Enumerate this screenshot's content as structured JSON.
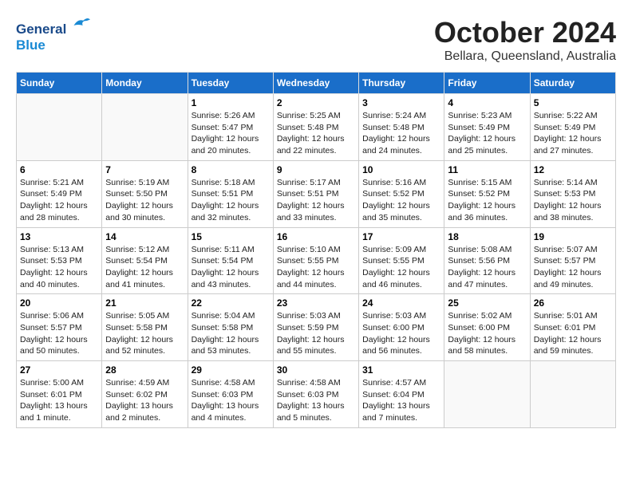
{
  "header": {
    "logo_general": "General",
    "logo_blue": "Blue",
    "month_title": "October 2024",
    "subtitle": "Bellara, Queensland, Australia"
  },
  "weekdays": [
    "Sunday",
    "Monday",
    "Tuesday",
    "Wednesday",
    "Thursday",
    "Friday",
    "Saturday"
  ],
  "weeks": [
    [
      {
        "day": "",
        "sunrise": "",
        "sunset": "",
        "daylight": ""
      },
      {
        "day": "",
        "sunrise": "",
        "sunset": "",
        "daylight": ""
      },
      {
        "day": "1",
        "sunrise": "Sunrise: 5:26 AM",
        "sunset": "Sunset: 5:47 PM",
        "daylight": "Daylight: 12 hours and 20 minutes."
      },
      {
        "day": "2",
        "sunrise": "Sunrise: 5:25 AM",
        "sunset": "Sunset: 5:48 PM",
        "daylight": "Daylight: 12 hours and 22 minutes."
      },
      {
        "day": "3",
        "sunrise": "Sunrise: 5:24 AM",
        "sunset": "Sunset: 5:48 PM",
        "daylight": "Daylight: 12 hours and 24 minutes."
      },
      {
        "day": "4",
        "sunrise": "Sunrise: 5:23 AM",
        "sunset": "Sunset: 5:49 PM",
        "daylight": "Daylight: 12 hours and 25 minutes."
      },
      {
        "day": "5",
        "sunrise": "Sunrise: 5:22 AM",
        "sunset": "Sunset: 5:49 PM",
        "daylight": "Daylight: 12 hours and 27 minutes."
      }
    ],
    [
      {
        "day": "6",
        "sunrise": "Sunrise: 5:21 AM",
        "sunset": "Sunset: 5:49 PM",
        "daylight": "Daylight: 12 hours and 28 minutes."
      },
      {
        "day": "7",
        "sunrise": "Sunrise: 5:19 AM",
        "sunset": "Sunset: 5:50 PM",
        "daylight": "Daylight: 12 hours and 30 minutes."
      },
      {
        "day": "8",
        "sunrise": "Sunrise: 5:18 AM",
        "sunset": "Sunset: 5:51 PM",
        "daylight": "Daylight: 12 hours and 32 minutes."
      },
      {
        "day": "9",
        "sunrise": "Sunrise: 5:17 AM",
        "sunset": "Sunset: 5:51 PM",
        "daylight": "Daylight: 12 hours and 33 minutes."
      },
      {
        "day": "10",
        "sunrise": "Sunrise: 5:16 AM",
        "sunset": "Sunset: 5:52 PM",
        "daylight": "Daylight: 12 hours and 35 minutes."
      },
      {
        "day": "11",
        "sunrise": "Sunrise: 5:15 AM",
        "sunset": "Sunset: 5:52 PM",
        "daylight": "Daylight: 12 hours and 36 minutes."
      },
      {
        "day": "12",
        "sunrise": "Sunrise: 5:14 AM",
        "sunset": "Sunset: 5:53 PM",
        "daylight": "Daylight: 12 hours and 38 minutes."
      }
    ],
    [
      {
        "day": "13",
        "sunrise": "Sunrise: 5:13 AM",
        "sunset": "Sunset: 5:53 PM",
        "daylight": "Daylight: 12 hours and 40 minutes."
      },
      {
        "day": "14",
        "sunrise": "Sunrise: 5:12 AM",
        "sunset": "Sunset: 5:54 PM",
        "daylight": "Daylight: 12 hours and 41 minutes."
      },
      {
        "day": "15",
        "sunrise": "Sunrise: 5:11 AM",
        "sunset": "Sunset: 5:54 PM",
        "daylight": "Daylight: 12 hours and 43 minutes."
      },
      {
        "day": "16",
        "sunrise": "Sunrise: 5:10 AM",
        "sunset": "Sunset: 5:55 PM",
        "daylight": "Daylight: 12 hours and 44 minutes."
      },
      {
        "day": "17",
        "sunrise": "Sunrise: 5:09 AM",
        "sunset": "Sunset: 5:55 PM",
        "daylight": "Daylight: 12 hours and 46 minutes."
      },
      {
        "day": "18",
        "sunrise": "Sunrise: 5:08 AM",
        "sunset": "Sunset: 5:56 PM",
        "daylight": "Daylight: 12 hours and 47 minutes."
      },
      {
        "day": "19",
        "sunrise": "Sunrise: 5:07 AM",
        "sunset": "Sunset: 5:57 PM",
        "daylight": "Daylight: 12 hours and 49 minutes."
      }
    ],
    [
      {
        "day": "20",
        "sunrise": "Sunrise: 5:06 AM",
        "sunset": "Sunset: 5:57 PM",
        "daylight": "Daylight: 12 hours and 50 minutes."
      },
      {
        "day": "21",
        "sunrise": "Sunrise: 5:05 AM",
        "sunset": "Sunset: 5:58 PM",
        "daylight": "Daylight: 12 hours and 52 minutes."
      },
      {
        "day": "22",
        "sunrise": "Sunrise: 5:04 AM",
        "sunset": "Sunset: 5:58 PM",
        "daylight": "Daylight: 12 hours and 53 minutes."
      },
      {
        "day": "23",
        "sunrise": "Sunrise: 5:03 AM",
        "sunset": "Sunset: 5:59 PM",
        "daylight": "Daylight: 12 hours and 55 minutes."
      },
      {
        "day": "24",
        "sunrise": "Sunrise: 5:03 AM",
        "sunset": "Sunset: 6:00 PM",
        "daylight": "Daylight: 12 hours and 56 minutes."
      },
      {
        "day": "25",
        "sunrise": "Sunrise: 5:02 AM",
        "sunset": "Sunset: 6:00 PM",
        "daylight": "Daylight: 12 hours and 58 minutes."
      },
      {
        "day": "26",
        "sunrise": "Sunrise: 5:01 AM",
        "sunset": "Sunset: 6:01 PM",
        "daylight": "Daylight: 12 hours and 59 minutes."
      }
    ],
    [
      {
        "day": "27",
        "sunrise": "Sunrise: 5:00 AM",
        "sunset": "Sunset: 6:01 PM",
        "daylight": "Daylight: 13 hours and 1 minute."
      },
      {
        "day": "28",
        "sunrise": "Sunrise: 4:59 AM",
        "sunset": "Sunset: 6:02 PM",
        "daylight": "Daylight: 13 hours and 2 minutes."
      },
      {
        "day": "29",
        "sunrise": "Sunrise: 4:58 AM",
        "sunset": "Sunset: 6:03 PM",
        "daylight": "Daylight: 13 hours and 4 minutes."
      },
      {
        "day": "30",
        "sunrise": "Sunrise: 4:58 AM",
        "sunset": "Sunset: 6:03 PM",
        "daylight": "Daylight: 13 hours and 5 minutes."
      },
      {
        "day": "31",
        "sunrise": "Sunrise: 4:57 AM",
        "sunset": "Sunset: 6:04 PM",
        "daylight": "Daylight: 13 hours and 7 minutes."
      },
      {
        "day": "",
        "sunrise": "",
        "sunset": "",
        "daylight": ""
      },
      {
        "day": "",
        "sunrise": "",
        "sunset": "",
        "daylight": ""
      }
    ]
  ]
}
